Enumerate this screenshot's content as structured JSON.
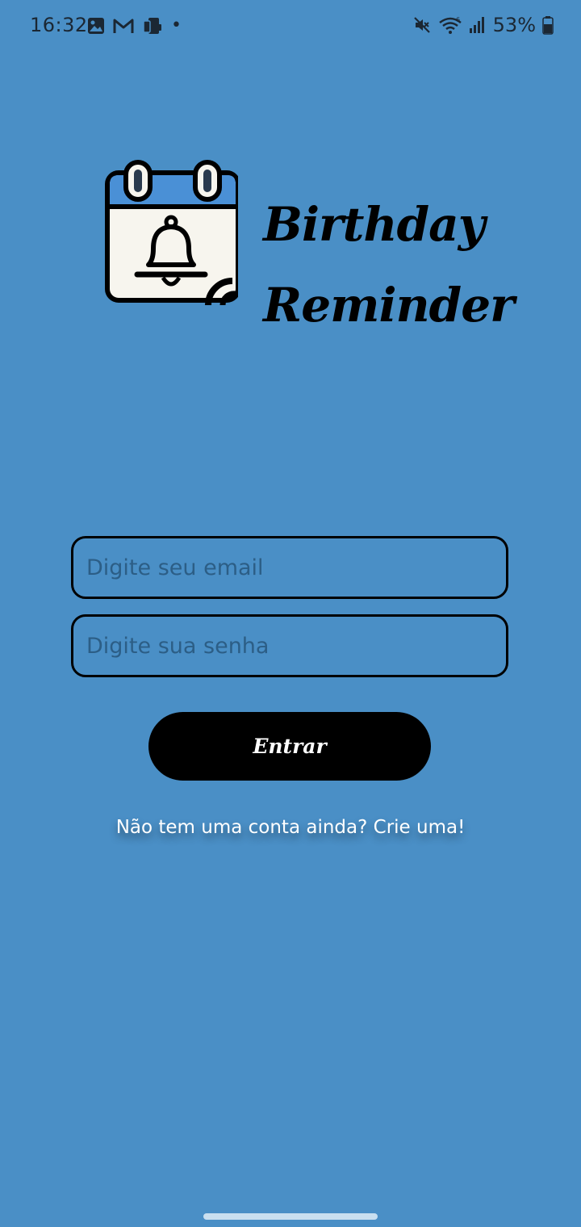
{
  "status_bar": {
    "time": "16:32",
    "dot": "•",
    "battery": "53%",
    "icons_left": [
      "gallery-icon",
      "gmail-icon",
      "device-icon"
    ],
    "icons_right": [
      "mute-icon",
      "wifi-icon",
      "signal-icon",
      "battery-icon"
    ]
  },
  "app": {
    "title_line1": "Birthday",
    "title_line2": "Reminder"
  },
  "form": {
    "email_placeholder": "Digite seu email",
    "password_placeholder": "Digite sua senha",
    "email_value": "",
    "password_value": ""
  },
  "actions": {
    "login_label": "Entrar",
    "signup_text": "Não tem uma conta ainda? Crie uma!"
  },
  "colors": {
    "background": "#4a8fc6",
    "button": "#000000",
    "calendar_header": "#4a90d6"
  }
}
